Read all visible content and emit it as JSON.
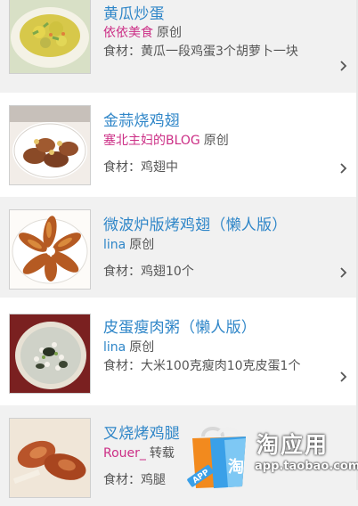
{
  "recipes": [
    {
      "title": "黄瓜炒蛋",
      "author": "依依美食",
      "tag": "原创",
      "ingredients": "食材：黄瓜一段鸡蛋3个胡萝卜一块",
      "thumb_icon": "cucumber-egg-dish-image"
    },
    {
      "title": "金蒜烧鸡翅",
      "author": "塞北主妇的BLOG",
      "tag": "原创",
      "ingredients": "食材：鸡翅中",
      "thumb_icon": "garlic-chicken-wings-image"
    },
    {
      "title": "微波炉版烤鸡翅（懒人版）",
      "author": "lina",
      "tag": "原创",
      "ingredients": "食材：鸡翅10个",
      "thumb_icon": "microwave-chicken-wings-image"
    },
    {
      "title": "皮蛋瘦肉粥（懒人版）",
      "author": "lina",
      "tag": "原创",
      "ingredients": "食材：大米100克瘦肉10克皮蛋1个",
      "thumb_icon": "century-egg-congee-image"
    },
    {
      "title": "叉烧烤鸡腿",
      "author": "Rouer_",
      "tag": "转载",
      "ingredients": "食材：鸡腿",
      "thumb_icon": "bbq-chicken-leg-image"
    }
  ],
  "watermark": {
    "brand": "淘应用",
    "url": "app.taobao.com",
    "bag_char": "淘",
    "app_badge": "APP"
  },
  "colors": {
    "title": "#2f86c8",
    "author_pink": "#cc2f86",
    "author_blue": "#2f86c8",
    "text_gray": "#555555",
    "row_alt": "#f1f1f1"
  }
}
